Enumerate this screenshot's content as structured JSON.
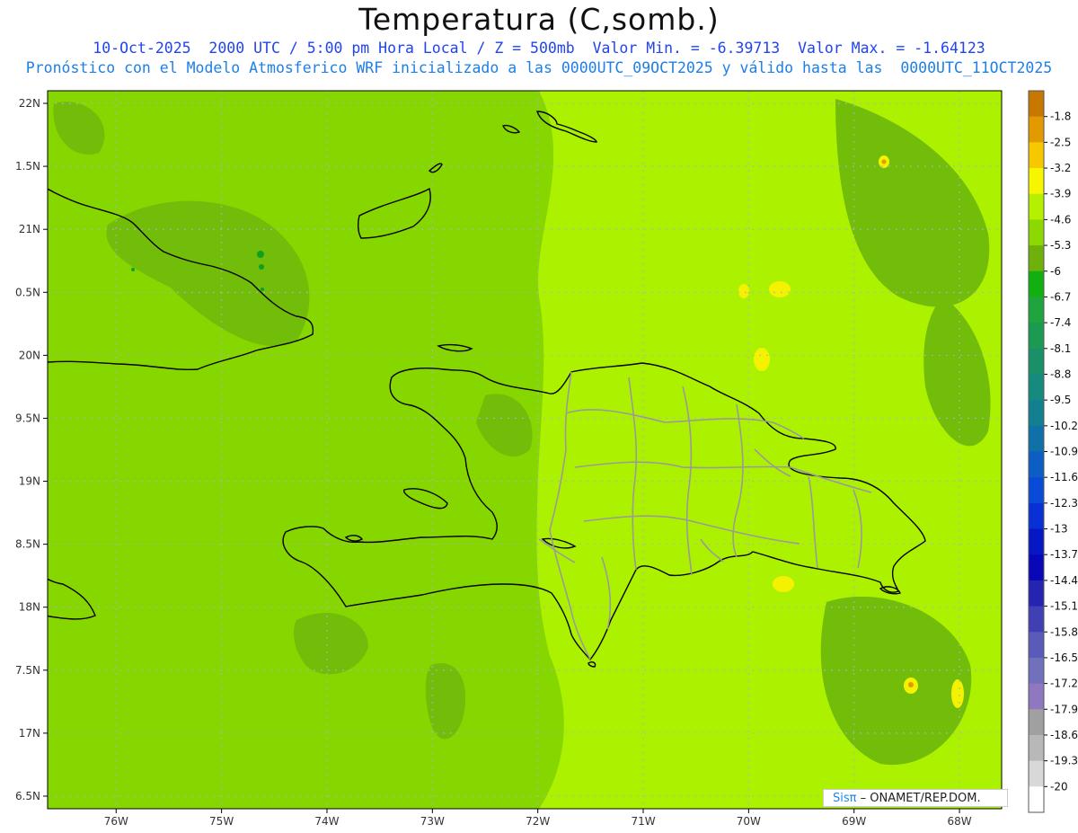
{
  "header": {
    "title": "Temperatura (C,somb.)",
    "subtitle_line1": "10-Oct-2025  2000 UTC / 5:00 pm Hora Local / Z = 500mb  Valor Min. = -6.39713  Valor Max. = -1.64123",
    "subtitle_line2": "Pronóstico con el Modelo Atmosferico WRF inicializado a las 0000UTC_09OCT2025 y válido hasta las  0000UTC_11OCT2025"
  },
  "credit": {
    "brand": "Sisπ",
    "text": " – ONAMET/REP.DOM."
  },
  "colors": {
    "water_field": "#80d800",
    "east_field": "#acf200",
    "west_field": "#8ad800",
    "cool_patch": "#6eb80e",
    "coastline": "#000000",
    "province_border": "#999999",
    "grid": "#aab0d0"
  },
  "chart_data": {
    "type": "heatmap",
    "title": "Temperatura (C,somb.)",
    "level": "500mb",
    "valid_time": "10-Oct-2025 2000 UTC",
    "local_time": "5:00 pm Hora Local",
    "min_value": -6.39713,
    "max_value": -1.64123,
    "lon_range": [
      -76.65,
      -67.6
    ],
    "lat_range": [
      16.4,
      22.1
    ],
    "x_ticks": [
      {
        "lon": -76,
        "label": "76W"
      },
      {
        "lon": -75,
        "label": "75W"
      },
      {
        "lon": -74,
        "label": "74W"
      },
      {
        "lon": -73,
        "label": "73W"
      },
      {
        "lon": -72,
        "label": "72W"
      },
      {
        "lon": -71,
        "label": "71W"
      },
      {
        "lon": -70,
        "label": "70W"
      },
      {
        "lon": -69,
        "label": "69W"
      },
      {
        "lon": -68,
        "label": "68W"
      }
    ],
    "y_ticks": [
      {
        "lat": 22,
        "label": "22N"
      },
      {
        "lat": 21.5,
        "label": "1.5N"
      },
      {
        "lat": 21,
        "label": "21N"
      },
      {
        "lat": 20.5,
        "label": "0.5N"
      },
      {
        "lat": 20,
        "label": "20N"
      },
      {
        "lat": 19.5,
        "label": "9.5N"
      },
      {
        "lat": 19,
        "label": "19N"
      },
      {
        "lat": 18.5,
        "label": "8.5N"
      },
      {
        "lat": 18,
        "label": "18N"
      },
      {
        "lat": 17.5,
        "label": "7.5N"
      },
      {
        "lat": 17,
        "label": "17N"
      },
      {
        "lat": 16.5,
        "label": "6.5N"
      }
    ],
    "grid": true,
    "colorbar": [
      {
        "label": "-1.8",
        "color": "#c87800"
      },
      {
        "label": "-2.5",
        "color": "#e29a00"
      },
      {
        "label": "-3.2",
        "color": "#f6c800"
      },
      {
        "label": "-3.9",
        "color": "#f6f600"
      },
      {
        "label": "-4.6",
        "color": "#b4f000"
      },
      {
        "label": "-5.3",
        "color": "#8cd800"
      },
      {
        "label": "-6",
        "color": "#70b00a"
      },
      {
        "label": "-6.7",
        "color": "#10b010"
      },
      {
        "label": "-7.4",
        "color": "#1ea53e"
      },
      {
        "label": "-8.1",
        "color": "#1d9a52"
      },
      {
        "label": "-8.8",
        "color": "#1a9068"
      },
      {
        "label": "-9.5",
        "color": "#168a7e"
      },
      {
        "label": "-10.2",
        "color": "#128090"
      },
      {
        "label": "-10.9",
        "color": "#1070a8"
      },
      {
        "label": "-11.6",
        "color": "#0c5ec4"
      },
      {
        "label": "-12.3",
        "color": "#0a4ad8"
      },
      {
        "label": "-13",
        "color": "#0830d4"
      },
      {
        "label": "-13.7",
        "color": "#0618c4"
      },
      {
        "label": "-14.4",
        "color": "#0808b8"
      },
      {
        "label": "-15.1",
        "color": "#2424b0"
      },
      {
        "label": "-15.8",
        "color": "#4040b4"
      },
      {
        "label": "-16.5",
        "color": "#5a5ab8"
      },
      {
        "label": "-17.2",
        "color": "#7070bc"
      },
      {
        "label": "-17.9",
        "color": "#9078c0"
      },
      {
        "label": "-18.6",
        "color": "#a0a0a0"
      },
      {
        "label": "-19.3",
        "color": "#b8b8b8"
      },
      {
        "label": "-20",
        "color": "#d8d8d8"
      },
      {
        "label": "",
        "color": "#ffffff"
      }
    ]
  }
}
